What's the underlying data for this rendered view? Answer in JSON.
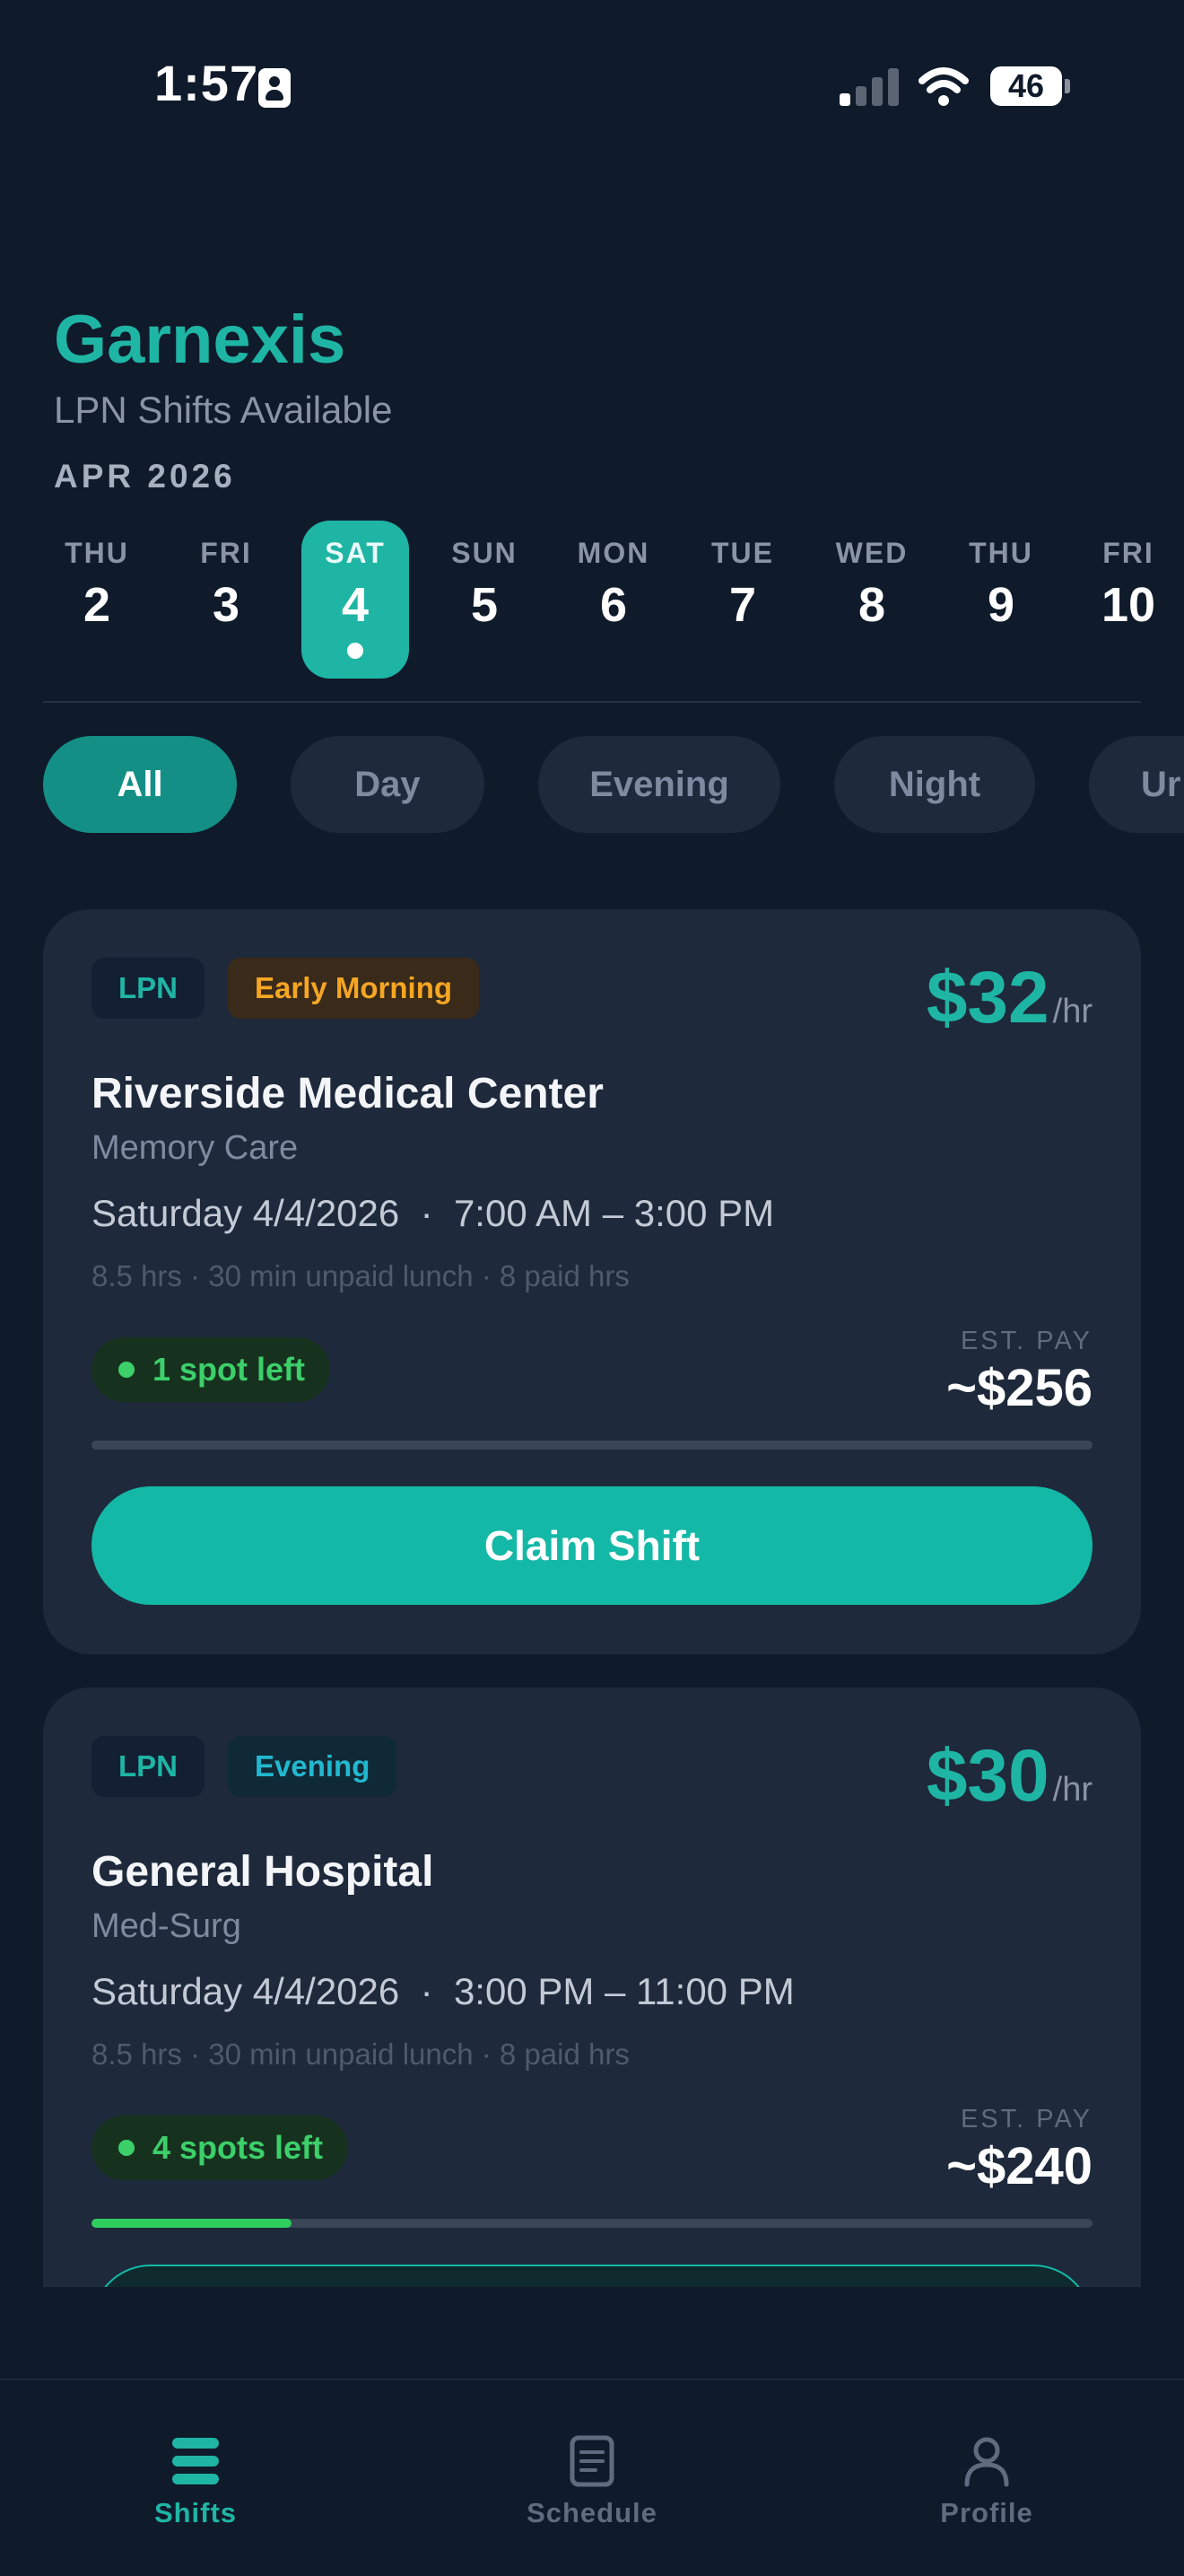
{
  "status_bar": {
    "time": "1:57",
    "battery": "46"
  },
  "header": {
    "brand": "Garnexis",
    "subtitle": "LPN Shifts Available",
    "month": "APR 2026"
  },
  "dates": [
    {
      "dow": "THU",
      "num": "2"
    },
    {
      "dow": "FRI",
      "num": "3"
    },
    {
      "dow": "SAT",
      "num": "4",
      "selected": true
    },
    {
      "dow": "SUN",
      "num": "5"
    },
    {
      "dow": "MON",
      "num": "6"
    },
    {
      "dow": "TUE",
      "num": "7"
    },
    {
      "dow": "WED",
      "num": "8"
    },
    {
      "dow": "THU",
      "num": "9"
    },
    {
      "dow": "FRI",
      "num": "10"
    }
  ],
  "filters": [
    "All",
    "Day",
    "Evening",
    "Night",
    "Ur"
  ],
  "shifts": [
    {
      "role": "LPN",
      "period": "Early Morning",
      "rate": "$32",
      "rate_unit": "/hr",
      "facility": "Riverside Medical Center",
      "unit": "Memory Care",
      "date": "Saturday 4/4/2026",
      "time": "7:00 AM – 3:00 PM",
      "details": "8.5 hrs · 30 min unpaid lunch · 8 paid hrs",
      "spots": "1 spot left",
      "spots_filled_fraction": 0,
      "est_label": "EST. PAY",
      "est_pay": "~$256",
      "cta": "Claim Shift"
    },
    {
      "role": "LPN",
      "period": "Evening",
      "rate": "$30",
      "rate_unit": "/hr",
      "facility": "General Hospital",
      "unit": "Med-Surg",
      "date": "Saturday 4/4/2026",
      "time": "3:00 PM – 11:00 PM",
      "details": "8.5 hrs · 30 min unpaid lunch · 8 paid hrs",
      "spots": "4 spots left",
      "spots_filled_fraction": 0.2,
      "est_label": "EST. PAY",
      "est_pay": "~$240"
    }
  ],
  "nav": [
    {
      "label": "Shifts",
      "icon": "shifts-icon",
      "active": true
    },
    {
      "label": "Schedule",
      "icon": "schedule-icon"
    },
    {
      "label": "Profile",
      "icon": "profile-icon"
    }
  ],
  "colors": {
    "accent": "#1fb5a4",
    "background": "#0f1a2b",
    "card": "#1e293b",
    "success": "#3ccf6a",
    "warning": "#f5a623"
  }
}
